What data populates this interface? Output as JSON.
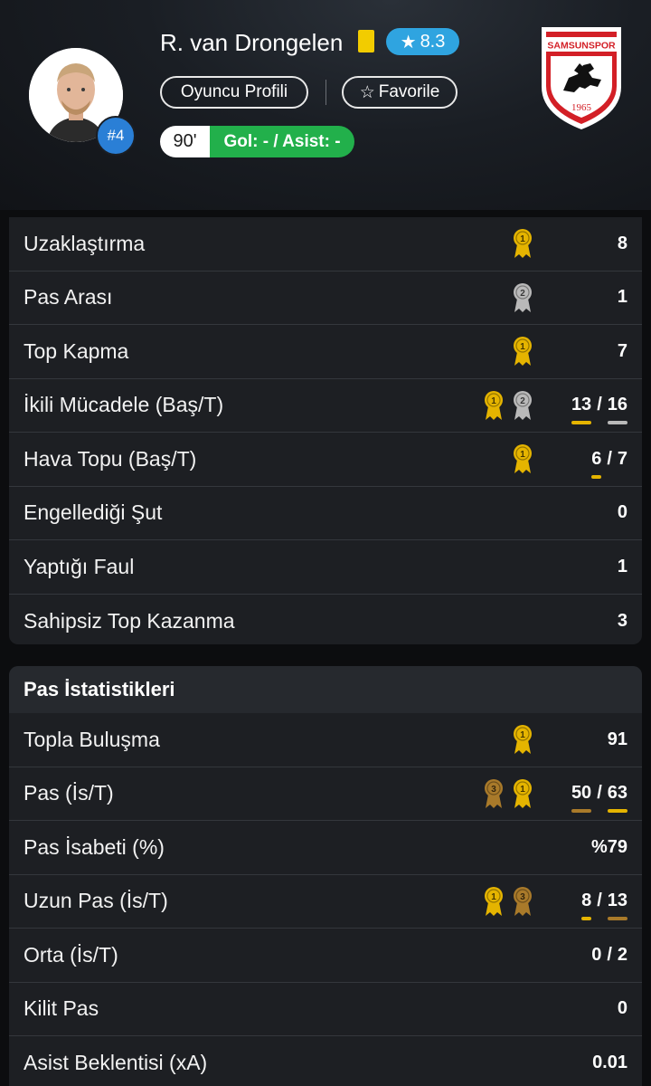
{
  "player": {
    "name": "R. van Drongelen",
    "number": "#4",
    "rating": "8.3",
    "profile_label": "Oyuncu Profili",
    "favorite_label": "Favorile",
    "minutes": "90'",
    "goal_assist": "Gol: - / Asist: -"
  },
  "club": {
    "logo_text": "SAMSUNSPOR",
    "logo_year": "1965"
  },
  "colors": {
    "rating_badge": "#2fa4e0",
    "yellow_card": "#f2cc00",
    "goal_assist_bg": "#22b04b",
    "number_badge": "#2a7fd6",
    "medal_gold": "#e5b400",
    "medal_silver": "#b9b9b9",
    "medal_bronze": "#a97a2a"
  },
  "defense_stats": [
    {
      "label": "Uzaklaştırma",
      "medals": [
        "gold"
      ],
      "value": "8"
    },
    {
      "label": "Pas Arası",
      "medals": [
        "silver"
      ],
      "value": "1"
    },
    {
      "label": "Top Kapma",
      "medals": [
        "gold"
      ],
      "value": "7"
    },
    {
      "label": "İkili Mücadele (Baş/T)",
      "medals": [
        "gold",
        "silver"
      ],
      "value_a": "13",
      "value_b": "16",
      "underline_a": "gold",
      "underline_b": "silver"
    },
    {
      "label": "Hava Topu (Baş/T)",
      "medals": [
        "gold"
      ],
      "value_a": "6",
      "value_b": "7",
      "underline_a": "gold"
    },
    {
      "label": "Engellediği Şut",
      "medals": [],
      "value": "0"
    },
    {
      "label": "Yaptığı Faul",
      "medals": [],
      "value": "1"
    },
    {
      "label": "Sahipsiz Top Kazanma",
      "medals": [],
      "value": "3"
    }
  ],
  "passing": {
    "title": "Pas İstatistikleri",
    "stats": [
      {
        "label": "Topla Buluşma",
        "medals": [
          "gold"
        ],
        "value": "91"
      },
      {
        "label": "Pas (İs/T)",
        "medals": [
          "bronze",
          "gold"
        ],
        "value_a": "50",
        "value_b": "63",
        "underline_a": "bronze",
        "underline_b": "gold"
      },
      {
        "label": "Pas İsabeti (%)",
        "medals": [],
        "value": "%79"
      },
      {
        "label": "Uzun Pas (İs/T)",
        "medals": [
          "gold",
          "bronze"
        ],
        "value_a": "8",
        "value_b": "13",
        "underline_a": "gold",
        "underline_b": "bronze"
      },
      {
        "label": "Orta (İs/T)",
        "medals": [],
        "value_a": "0",
        "value_b": "2"
      },
      {
        "label": "Kilit Pas",
        "medals": [],
        "value": "0"
      },
      {
        "label": "Asist Beklentisi (xA)",
        "medals": [],
        "value": "0.01"
      }
    ]
  }
}
